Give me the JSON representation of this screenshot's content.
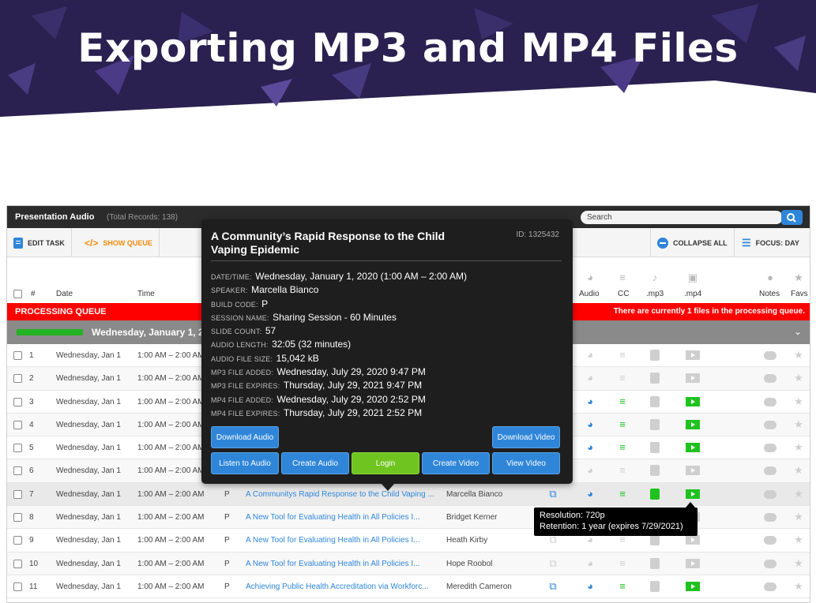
{
  "banner": {
    "title": "Exporting MP3 and MP4 Files"
  },
  "app": {
    "title": "Presentation Audio",
    "total_records": "(Total Records: 138)",
    "search_placeholder": "Search"
  },
  "toolbar": {
    "edit_task": "EDIT TASK",
    "show_queue": "SHOW QUEUE",
    "collapse_all": "COLLAPSE ALL",
    "focus_day": "FOCUS: DAY"
  },
  "columns": {
    "num": "#",
    "date": "Date",
    "time": "Time",
    "audio": "Audio",
    "cc": "CC",
    "mp3": ".mp3",
    "mp4": ".mp4",
    "notes": "Notes",
    "favs": "Favs"
  },
  "processing": {
    "label": "PROCESSING QUEUE",
    "message": "There are currently 1 files in the processing queue."
  },
  "day_group": {
    "label": "Wednesday, January 1, 20",
    "progress": 1.0
  },
  "rows": [
    {
      "num": "1",
      "date": "Wednesday, Jan 1",
      "time": "1:00 AM – 2:00 AM",
      "build": "",
      "title": "",
      "speaker": "",
      "share": false,
      "audio": false,
      "cc": false,
      "mp3": false,
      "mp4": false
    },
    {
      "num": "2",
      "date": "Wednesday, Jan 1",
      "time": "1:00 AM – 2:00 AM",
      "build": "",
      "title": "",
      "speaker": "",
      "share": false,
      "audio": false,
      "cc": false,
      "mp3": false,
      "mp4": false
    },
    {
      "num": "3",
      "date": "Wednesday, Jan 1",
      "time": "1:00 AM – 2:00 AM",
      "build": "",
      "title": "",
      "speaker": "",
      "share": false,
      "audio": true,
      "cc": true,
      "mp3": false,
      "mp4": true
    },
    {
      "num": "4",
      "date": "Wednesday, Jan 1",
      "time": "1:00 AM – 2:00 AM",
      "build": "",
      "title": "",
      "speaker": "",
      "share": false,
      "audio": true,
      "cc": true,
      "mp3": false,
      "mp4": true
    },
    {
      "num": "5",
      "date": "Wednesday, Jan 1",
      "time": "1:00 AM – 2:00 AM",
      "build": "",
      "title": "",
      "speaker": "",
      "share": false,
      "audio": true,
      "cc": true,
      "mp3": false,
      "mp4": true
    },
    {
      "num": "6",
      "date": "Wednesday, Jan 1",
      "time": "1:00 AM – 2:00 AM",
      "build": "",
      "title": "",
      "speaker": "",
      "share": false,
      "audio": false,
      "cc": false,
      "mp3": false,
      "mp4": false
    },
    {
      "num": "7",
      "date": "Wednesday, Jan 1",
      "time": "1:00 AM – 2:00 AM",
      "build": "P",
      "title": "A Communitys Rapid Response to the Child Vaping ...",
      "speaker": "Marcella Bianco",
      "share": true,
      "audio": true,
      "cc": true,
      "mp3": true,
      "mp4": true
    },
    {
      "num": "8",
      "date": "Wednesday, Jan 1",
      "time": "1:00 AM – 2:00 AM",
      "build": "P",
      "title": "A New Tool for Evaluating Health in All Policies I...",
      "speaker": "Bridget Kerner",
      "share": false,
      "audio": false,
      "cc": false,
      "mp3": false,
      "mp4": false
    },
    {
      "num": "9",
      "date": "Wednesday, Jan 1",
      "time": "1:00 AM – 2:00 AM",
      "build": "P",
      "title": "A New Tool for Evaluating Health in All Policies I...",
      "speaker": "Heath Kirby",
      "share": false,
      "audio": false,
      "cc": false,
      "mp3": false,
      "mp4": false
    },
    {
      "num": "10",
      "date": "Wednesday, Jan 1",
      "time": "1:00 AM – 2:00 AM",
      "build": "P",
      "title": "A New Tool for Evaluating Health in All Policies I...",
      "speaker": "Hope Roobol",
      "share": false,
      "audio": false,
      "cc": false,
      "mp3": false,
      "mp4": false
    },
    {
      "num": "11",
      "date": "Wednesday, Jan 1",
      "time": "1:00 AM – 2:00 AM",
      "build": "P",
      "title": "Achieving Public Health Accreditation via Workforc...",
      "speaker": "Meredith Cameron",
      "share": true,
      "audio": true,
      "cc": true,
      "mp3": false,
      "mp4": true
    }
  ],
  "popup": {
    "title": "A Community’s Rapid Response to the Child Vaping Epidemic",
    "id": "ID: 1325432",
    "details": [
      {
        "key": "DATE/TIME:",
        "value": "Wednesday, January 1, 2020 (1:00 AM – 2:00 AM)",
        "big": true
      },
      {
        "key": "SPEAKER:",
        "value": "Marcella Bianco"
      },
      {
        "key": "BUILD CODE:",
        "value": "P"
      },
      {
        "key": "SESSION NAME:",
        "value": "Sharing Session - 60 Minutes"
      },
      {
        "key": "SLIDE COUNT:",
        "value": "57"
      },
      {
        "key": "AUDIO LENGTH:",
        "value": "32:05 (32 minutes)"
      },
      {
        "key": "AUDIO FILE SIZE:",
        "value": "15,042 kB"
      },
      {
        "key": "MP3 FILE ADDED:",
        "value": "Wednesday, July 29, 2020 9:47 PM"
      },
      {
        "key": "MP3 FILE EXPIRES:",
        "value": "Thursday, July 29, 2021 9:47 PM"
      },
      {
        "key": "MP4 FILE ADDED:",
        "value": "Wednesday, July 29, 2020 2:52 PM"
      },
      {
        "key": "MP4 FILE EXPIRES:",
        "value": "Thursday, July 29, 2021 2:52 PM"
      }
    ],
    "buttons": {
      "download_audio": "Download Audio",
      "download_video": "Download Video",
      "listen_audio": "Listen to Audio",
      "create_audio": "Create Audio",
      "login": "Login",
      "create_video": "Create Video",
      "view_video": "View Video"
    }
  },
  "tooltip": {
    "line1": "Resolution: 720p",
    "line2": "Retention: 1 year (expires 7/29/2021)"
  },
  "colors": {
    "accent": "#2f86d9",
    "success": "#1fc21f",
    "alert": "#ff0000",
    "banner": "#2a2150"
  },
  "icons": [
    "search-icon",
    "edit-task-icon",
    "code-icon",
    "collapse-icon",
    "focus-icon",
    "audio-icon",
    "cc-icon",
    "mp3-icon",
    "mp4-icon",
    "notes-icon",
    "star-icon",
    "share-icon",
    "chevron-down-icon"
  ]
}
